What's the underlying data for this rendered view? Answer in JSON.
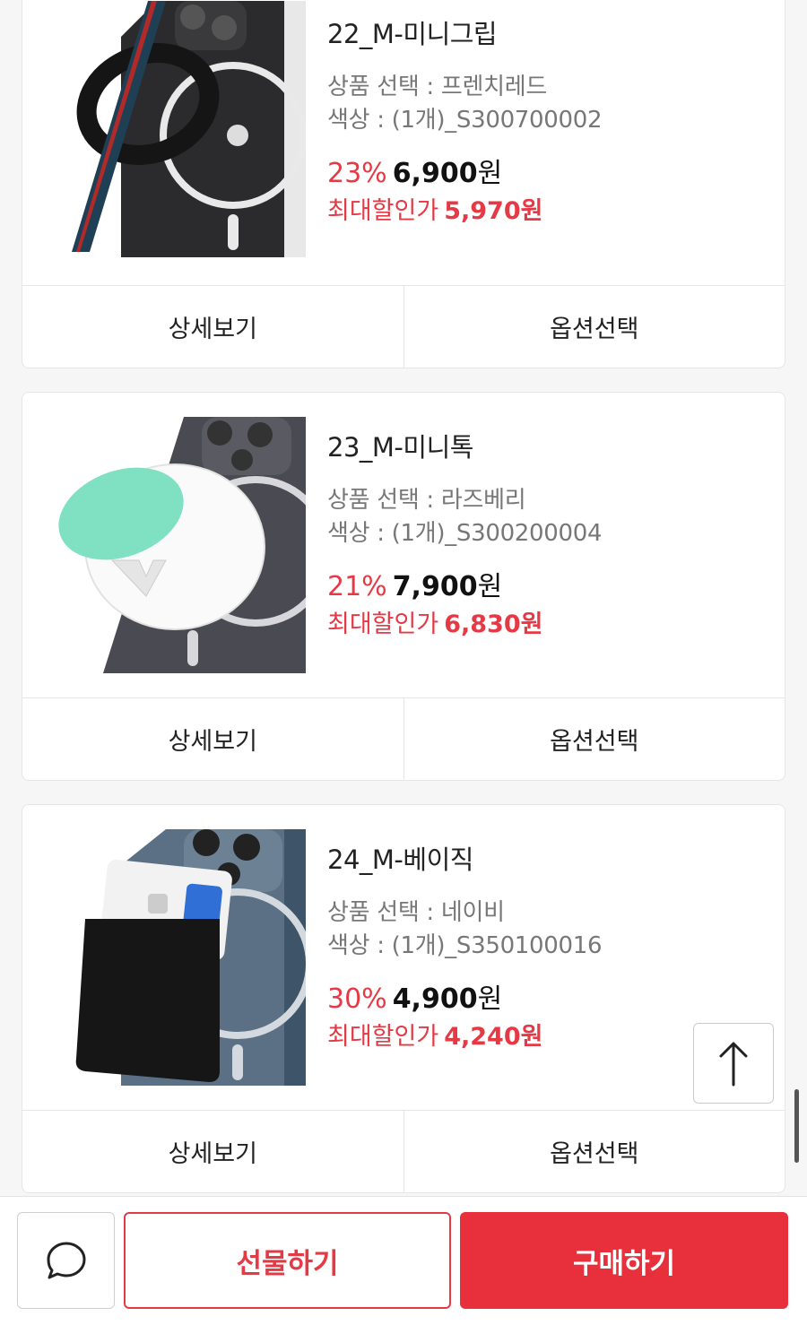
{
  "products": [
    {
      "name": "22_M-미니그립",
      "option_line": "상품 선택 : 프렌치레드",
      "color_line": "색상 : (1개)_S300700002",
      "discount_rate": "23%",
      "price": "6,900",
      "won": "원",
      "max_label": "최대할인가",
      "max_price": "5,970원",
      "detail_label": "상세보기",
      "option_label": "옵션선택"
    },
    {
      "name": "23_M-미니톡",
      "option_line": "상품 선택 : 라즈베리",
      "color_line": "색상 : (1개)_S300200004",
      "discount_rate": "21%",
      "price": "7,900",
      "won": "원",
      "max_label": "최대할인가",
      "max_price": "6,830원",
      "detail_label": "상세보기",
      "option_label": "옵션선택"
    },
    {
      "name": "24_M-베이직",
      "option_line": "상품 선택 : 네이비",
      "color_line": "색상 : (1개)_S350100016",
      "discount_rate": "30%",
      "price": "4,900",
      "won": "원",
      "max_label": "최대할인가",
      "max_price": "4,240원",
      "detail_label": "상세보기",
      "option_label": "옵션선택"
    }
  ],
  "bottom_bar": {
    "gift_label": "선물하기",
    "buy_label": "구매하기"
  },
  "icons": {
    "scroll_top": "arrow-up-icon",
    "chat": "chat-bubble-icon"
  },
  "colors": {
    "accent": "#e53945",
    "buy_button": "#e8303d"
  }
}
